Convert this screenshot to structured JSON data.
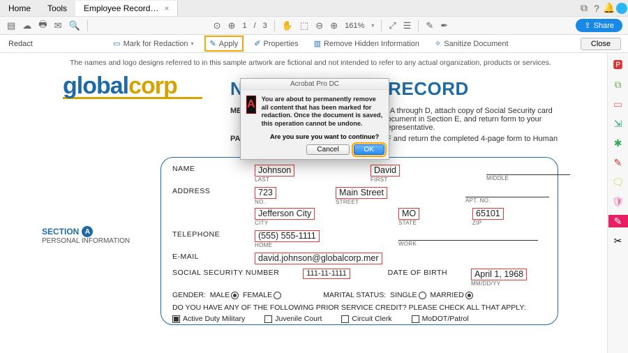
{
  "tabs": {
    "home": "Home",
    "tools": "Tools",
    "doc": "Employee Record…"
  },
  "toolbar": {
    "page_cur": "1",
    "page_sep": "/",
    "page_tot": "3",
    "zoom": "161%"
  },
  "share": "Share",
  "redact": {
    "label": "Redact",
    "mark": "Mark for Redaction",
    "apply": "Apply",
    "props": "Properties",
    "hidden": "Remove Hidden Information",
    "sanitize": "Sanitize Document",
    "close": "Close"
  },
  "disclaimer": "The names and logo designs referred to in this sample artwork are fictional and not intended to refer to any actual organization, products or services.",
  "logo": {
    "a": "global",
    "b": "corp"
  },
  "title": "NEW EMPLOYEE RECORD",
  "instr": {
    "k1": "MEMBER:",
    "v1": "Complete Sections A through D, attach copy of Social Security card and proof-of-age document in Section E, and return form to your payroll/personnel representative.",
    "k2": "PAYROLL/PERSONNEL:",
    "v2": "Complete Section F and return the completed 4-page form to Human Resources."
  },
  "section": {
    "label": "SECTION",
    "letter": "A",
    "sub": "PERSONAL INFORMATION"
  },
  "form": {
    "name_l": "NAME",
    "addr_l": "ADDRESS",
    "tel_l": "TELEPHONE",
    "email_l": "E-MAIL",
    "ssn_l": "SOCIAL SECURITY NUMBER",
    "dob_l": "DATE OF BIRTH",
    "last": "Johnson",
    "first": "David",
    "middle": "",
    "c_last": "LAST",
    "c_first": "FIRST",
    "c_mid": "MIDDLE",
    "no": "723",
    "street": "Main Street",
    "apt": "",
    "c_no": "NO.",
    "c_street": "STREET",
    "c_apt": "APT. NO.",
    "city": "Jefferson City",
    "state": "MO",
    "zip": "65101",
    "c_city": "CITY",
    "c_state": "STATE",
    "c_zip": "ZIP",
    "phone": "(555) 555-1111",
    "c_home": "HOME",
    "c_work": "WORK",
    "email": "david.johnson@globalcorp.mer",
    "ssn": "111-11-1111",
    "dob": "April 1, 1968",
    "c_dob": "MM/DD/YY",
    "gender_l": "GENDER:",
    "male": "MALE",
    "female": "FEMALE",
    "mar_l": "MARITAL STATUS:",
    "single": "SINGLE",
    "married": "MARRIED",
    "question": "DO YOU HAVE ANY OF THE FOLLOWING PRIOR SERVICE CREDIT? PLEASE CHECK ALL THAT APPLY:",
    "opt1": "Active Duty Military",
    "opt2": "Juvenile Court",
    "opt3": "Circuit Clerk",
    "opt4": "MoDOT/Patrol"
  },
  "dialog": {
    "title": "Acrobat Pro DC",
    "msg": "You are about to permanently remove all content that has been marked for redaction. Once the document is saved, this operation cannot be undone.",
    "q": "Are you sure you want to continue?",
    "cancel": "Cancel",
    "ok": "OK"
  }
}
